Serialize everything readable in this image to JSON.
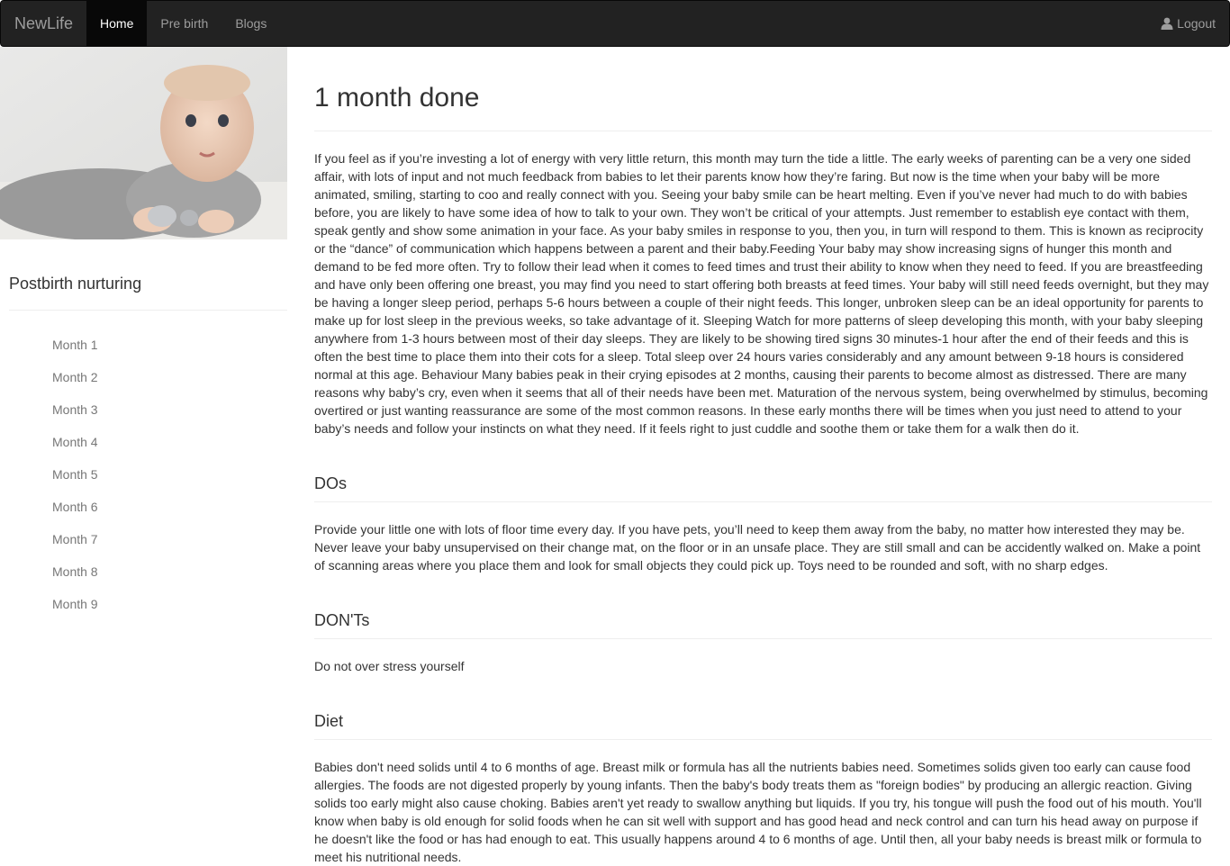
{
  "navbar": {
    "brand": "NewLife",
    "items": [
      {
        "label": "Home",
        "active": true
      },
      {
        "label": "Pre birth",
        "active": false
      },
      {
        "label": "Blogs",
        "active": false
      }
    ],
    "logout_label": "Logout",
    "logout_icon": "user-icon"
  },
  "sidebar": {
    "title": "Postbirth nurturing",
    "items": [
      {
        "label": "Month 1"
      },
      {
        "label": "Month 2"
      },
      {
        "label": "Month 3"
      },
      {
        "label": "Month 4"
      },
      {
        "label": "Month 5"
      },
      {
        "label": "Month 6"
      },
      {
        "label": "Month 7"
      },
      {
        "label": "Month 8"
      },
      {
        "label": "Month 9"
      }
    ]
  },
  "main": {
    "title": "1 month done",
    "intro": "If you feel as if you’re investing a lot of energy with very little return, this month may turn the tide a little. The early weeks of parenting can be a very one sided affair, with lots of input and not much feedback from babies to let their parents know how they’re faring. But now is the time when your baby will be more animated, smiling, starting to coo and really connect with you. Seeing your baby smile can be heart melting. Even if you’ve never had much to do with babies before, you are likely to have some idea of how to talk to your own. They won’t be critical of your attempts. Just remember to establish eye contact with them, speak gently and show some animation in your face. As your baby smiles in response to you, then you, in turn will respond to them. This is known as reciprocity or the “dance” of communication which happens between a parent and their baby.Feeding Your baby may show increasing signs of hunger this month and demand to be fed more often. Try to follow their lead when it comes to feed times and trust their ability to know when they need to feed. If you are breastfeeding and have only been offering one breast, you may find you need to start offering both breasts at feed times. Your baby will still need feeds overnight, but they may be having a longer sleep period, perhaps 5-6 hours between a couple of their night feeds. This longer, unbroken sleep can be an ideal opportunity for parents to make up for lost sleep in the previous weeks, so take advantage of it. Sleeping Watch for more patterns of sleep developing this month, with your baby sleeping anywhere from 1-3 hours between most of their day sleeps. They are likely to be showing tired signs 30 minutes-1 hour after the end of their feeds and this is often the best time to place them into their cots for a sleep. Total sleep over 24 hours varies considerably and any amount between 9-18 hours is considered normal at this age. Behaviour Many babies peak in their crying episodes at 2 months, causing their parents to become almost as distressed. There are many reasons why baby’s cry, even when it seems that all of their needs have been met. Maturation of the nervous system, being overwhelmed by stimulus, becoming overtired or just wanting reassurance are some of the most common reasons. In these early months there will be times when you just need to attend to your baby’s needs and follow your instincts on what they need. If it feels right to just cuddle and soothe them or take them for a walk then do it.",
    "dos_title": "DOs",
    "dos_text": "Provide your little one with lots of floor time every day. If you have pets, you’ll need to keep them away from the baby, no matter how interested they may be. Never leave your baby unsupervised on their change mat, on the floor or in an unsafe place. They are still small and can be accidently walked on. Make a point of scanning areas where you place them and look for small objects they could pick up. Toys need to be rounded and soft, with no sharp edges.",
    "donts_title": "DON'Ts",
    "donts_text": "Do not over stress yourself",
    "diet_title": "Diet",
    "diet_text": "Babies don't need solids until 4 to 6 months of age. Breast milk or formula has all the nutrients babies need. Sometimes solids given too early can cause food allergies. The foods are not digested properly by young infants. Then the baby's body treats them as \"foreign bodies\" by producing an allergic reaction. Giving solids too early might also cause choking. Babies aren't yet ready to swallow anything but liquids. If you try, his tongue will push the food out of his mouth. You'll know when baby is old enough for solid foods when he can sit well with support and has good head and neck control and can turn his head away on purpose if he doesn't like the food or has had enough to eat. This usually happens around 4 to 6 months of age. Until then, all your baby needs is breast milk or formula to meet his nutritional needs."
  }
}
